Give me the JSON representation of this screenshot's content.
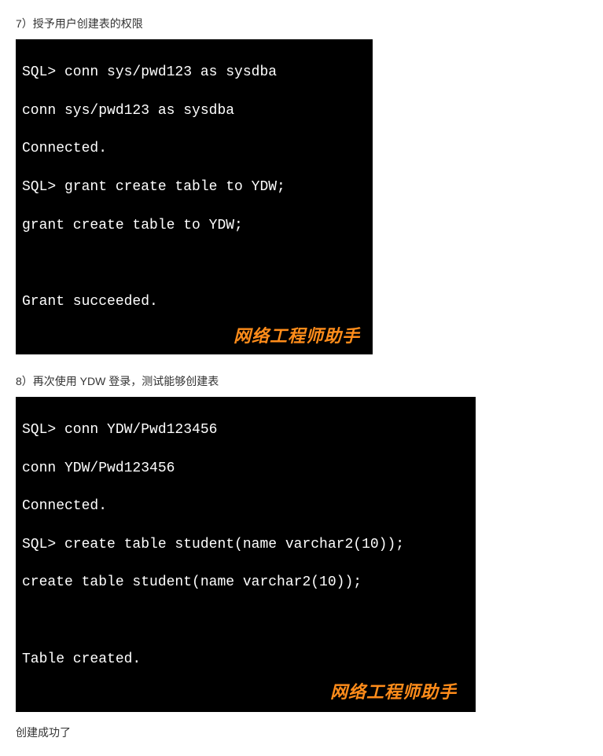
{
  "step7": {
    "heading": "7）授予用户创建表的权限",
    "lines": [
      "SQL> conn sys/pwd123 as sysdba",
      "conn sys/pwd123 as sysdba",
      "Connected.",
      "SQL> grant create table to YDW;",
      "grant create table to YDW;",
      "",
      "Grant succeeded."
    ],
    "watermark": "网络工程师助手"
  },
  "step8": {
    "heading": "8）再次使用 YDW 登录，测试能够创建表",
    "lines": [
      "SQL> conn YDW/Pwd123456",
      "conn YDW/Pwd123456",
      "Connected.",
      "SQL> create table student(name varchar2(10));",
      "create table student(name varchar2(10));",
      "",
      "Table created."
    ],
    "watermark": "网络工程师助手"
  },
  "final_text": "创建成功了"
}
